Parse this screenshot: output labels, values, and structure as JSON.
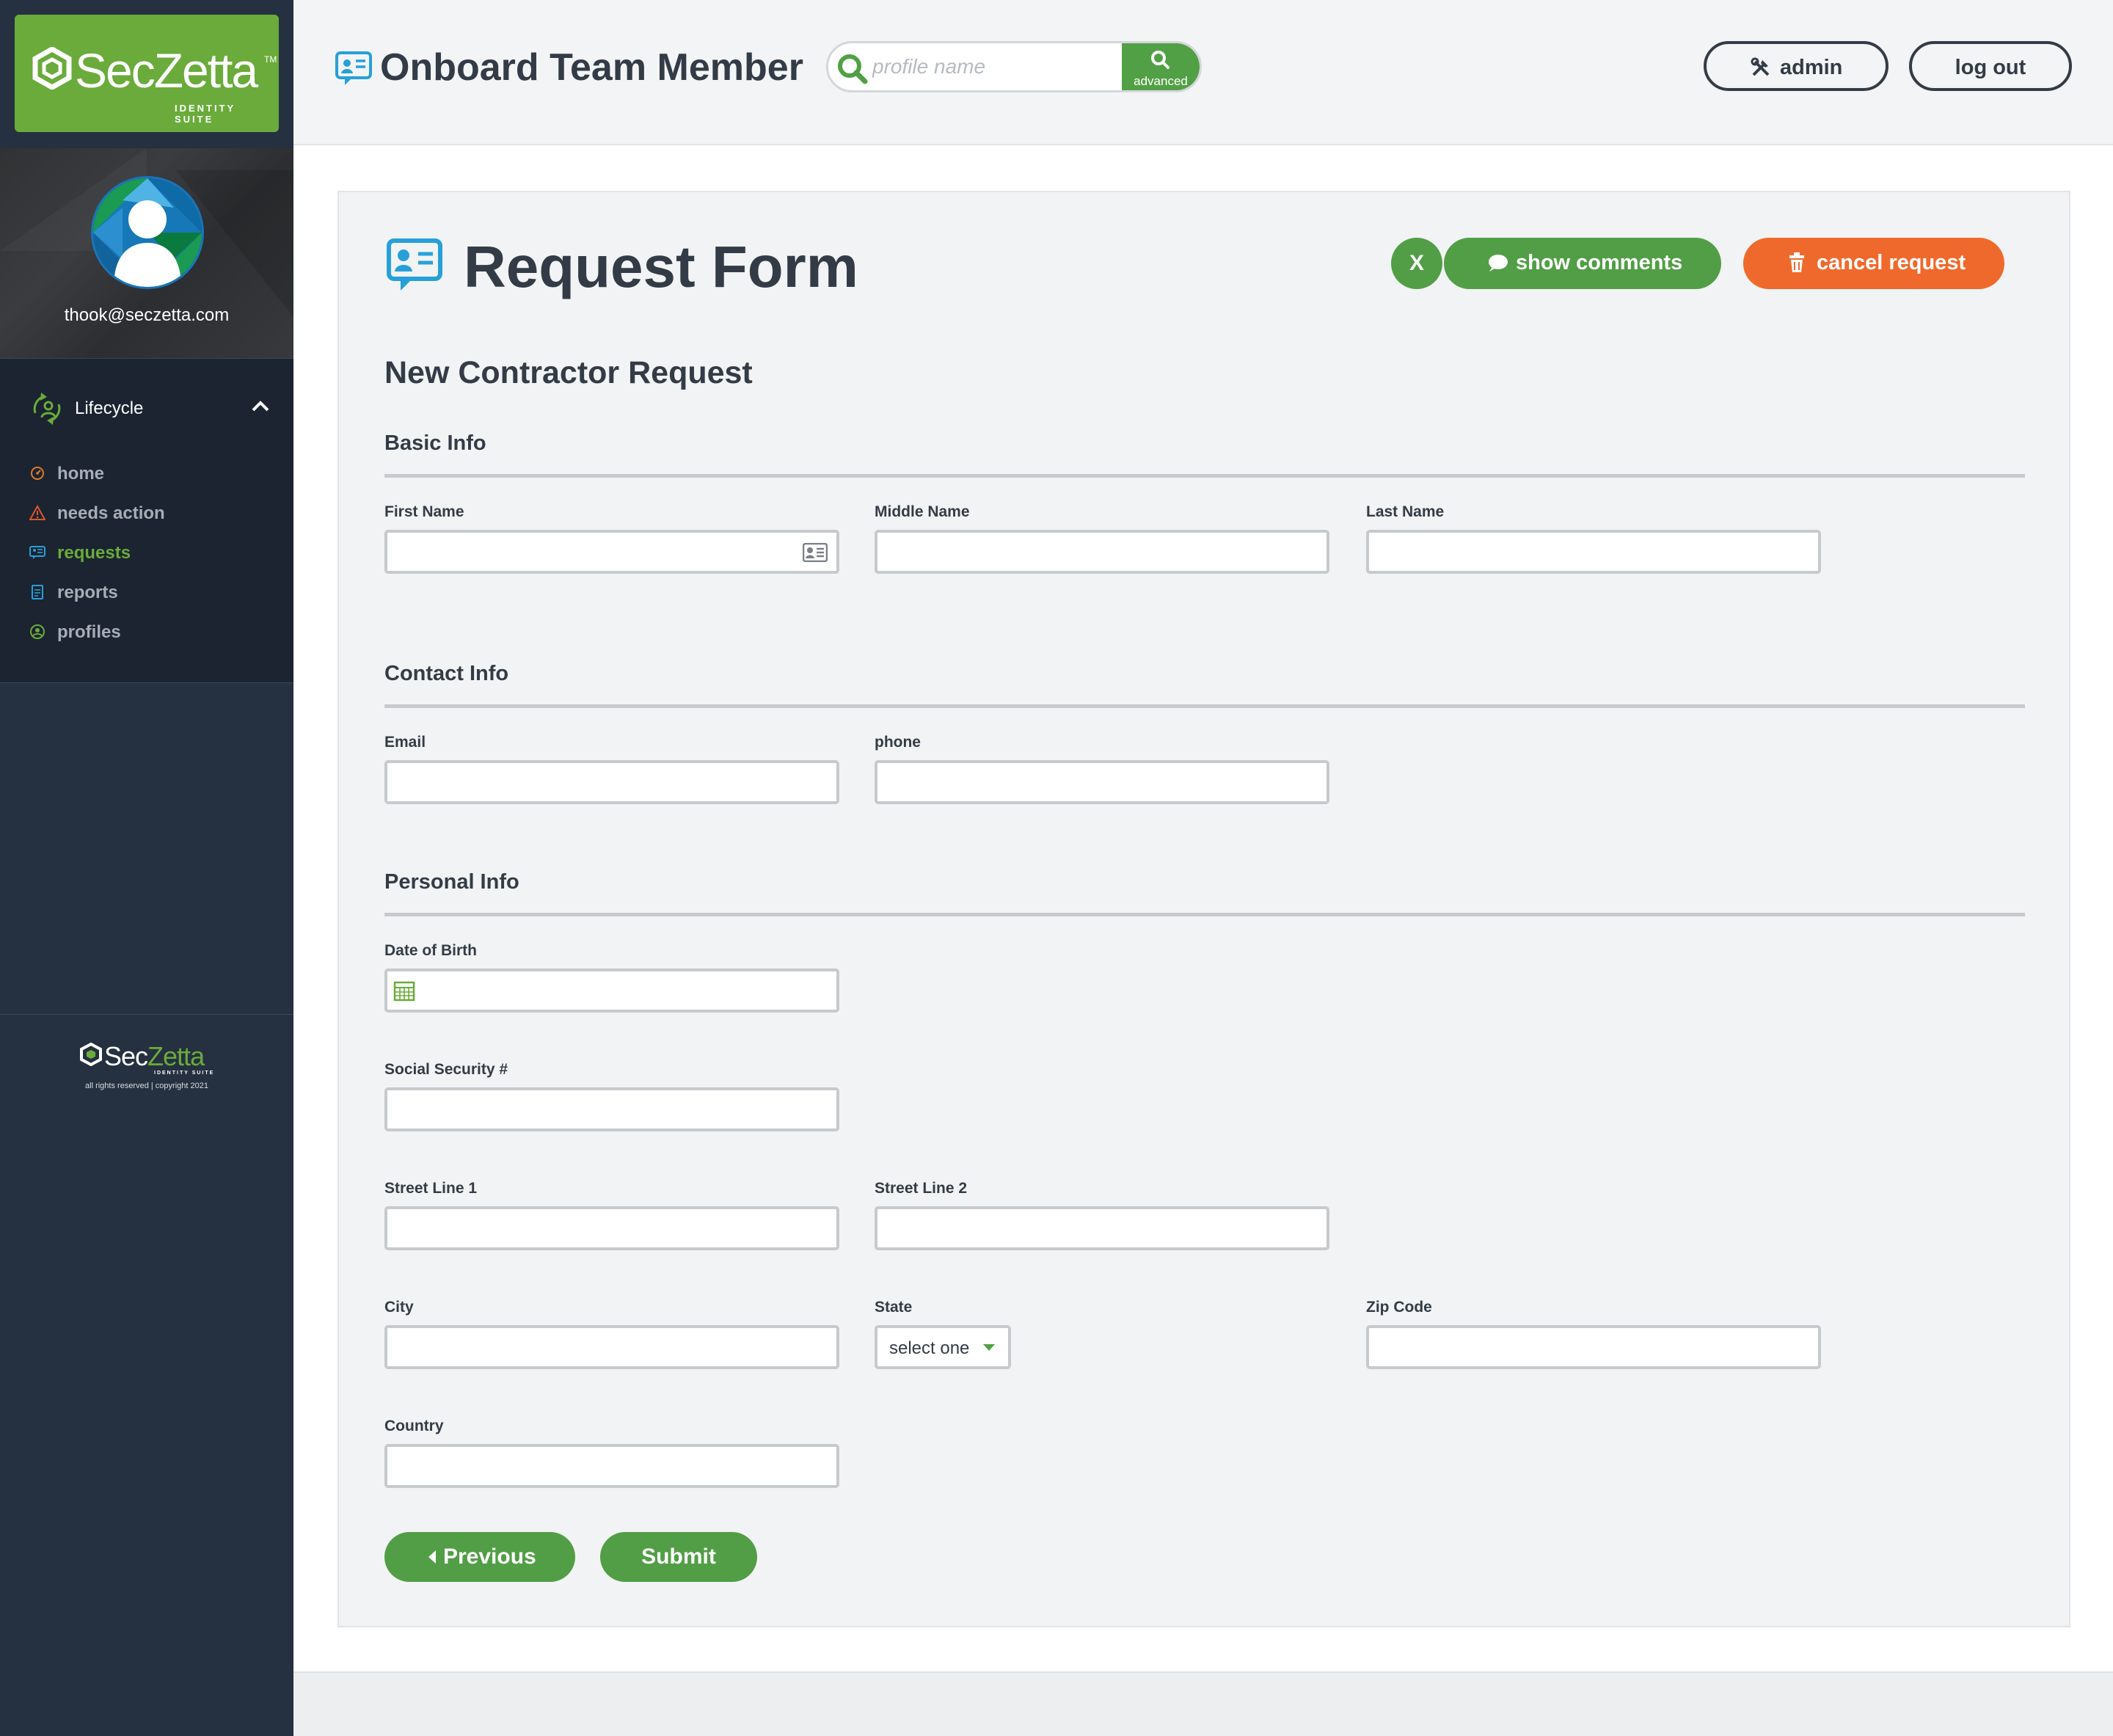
{
  "brand": {
    "name": "SecZetta",
    "tm": "TM",
    "suite": "IDENTITY SUITE"
  },
  "user": {
    "email": "thook@seczetta.com"
  },
  "sidebar": {
    "section_label": "Lifecycle",
    "items": [
      {
        "label": "home",
        "icon": "home-icon",
        "color": "#e07a2b"
      },
      {
        "label": "needs action",
        "icon": "warning-icon",
        "color": "#e0532b"
      },
      {
        "label": "requests",
        "icon": "requests-icon",
        "color": "#27a0d9",
        "active": true
      },
      {
        "label": "reports",
        "icon": "reports-icon",
        "color": "#27a0d9"
      },
      {
        "label": "profiles",
        "icon": "profiles-icon",
        "color": "#6aab3b"
      }
    ],
    "footer_brand": {
      "sec": "Sec",
      "zetta": "Zetta",
      "suite": "IDENTITY SUITE"
    },
    "copyright": "all rights reserved | copyright 2021"
  },
  "header": {
    "title": "Onboard Team Member",
    "search_placeholder": "profile name",
    "advanced_label": "advanced",
    "admin_label": "admin",
    "logout_label": "log out"
  },
  "form": {
    "title": "Request Form",
    "close_label": "X",
    "show_comments_label": "show comments",
    "cancel_label": "cancel request",
    "subtitle": "New Contractor Request",
    "sections": {
      "basic": "Basic Info",
      "contact": "Contact Info",
      "personal": "Personal Info"
    },
    "fields": {
      "first_name": "First Name",
      "middle_name": "Middle Name",
      "last_name": "Last Name",
      "email": "Email",
      "phone": "phone",
      "dob": "Date of Birth",
      "ssn": "Social Security #",
      "street1": "Street Line 1",
      "street2": "Street Line 2",
      "city": "City",
      "state": "State",
      "state_value": "select one",
      "zip": "Zip Code",
      "country": "Country"
    },
    "previous_label": "Previous",
    "submit_label": "Submit"
  },
  "colors": {
    "brand_green": "#6aab3b",
    "button_green": "#529e46",
    "cancel_orange": "#f0692c",
    "sidebar_bg": "#253040",
    "text_dark": "#333c46"
  }
}
